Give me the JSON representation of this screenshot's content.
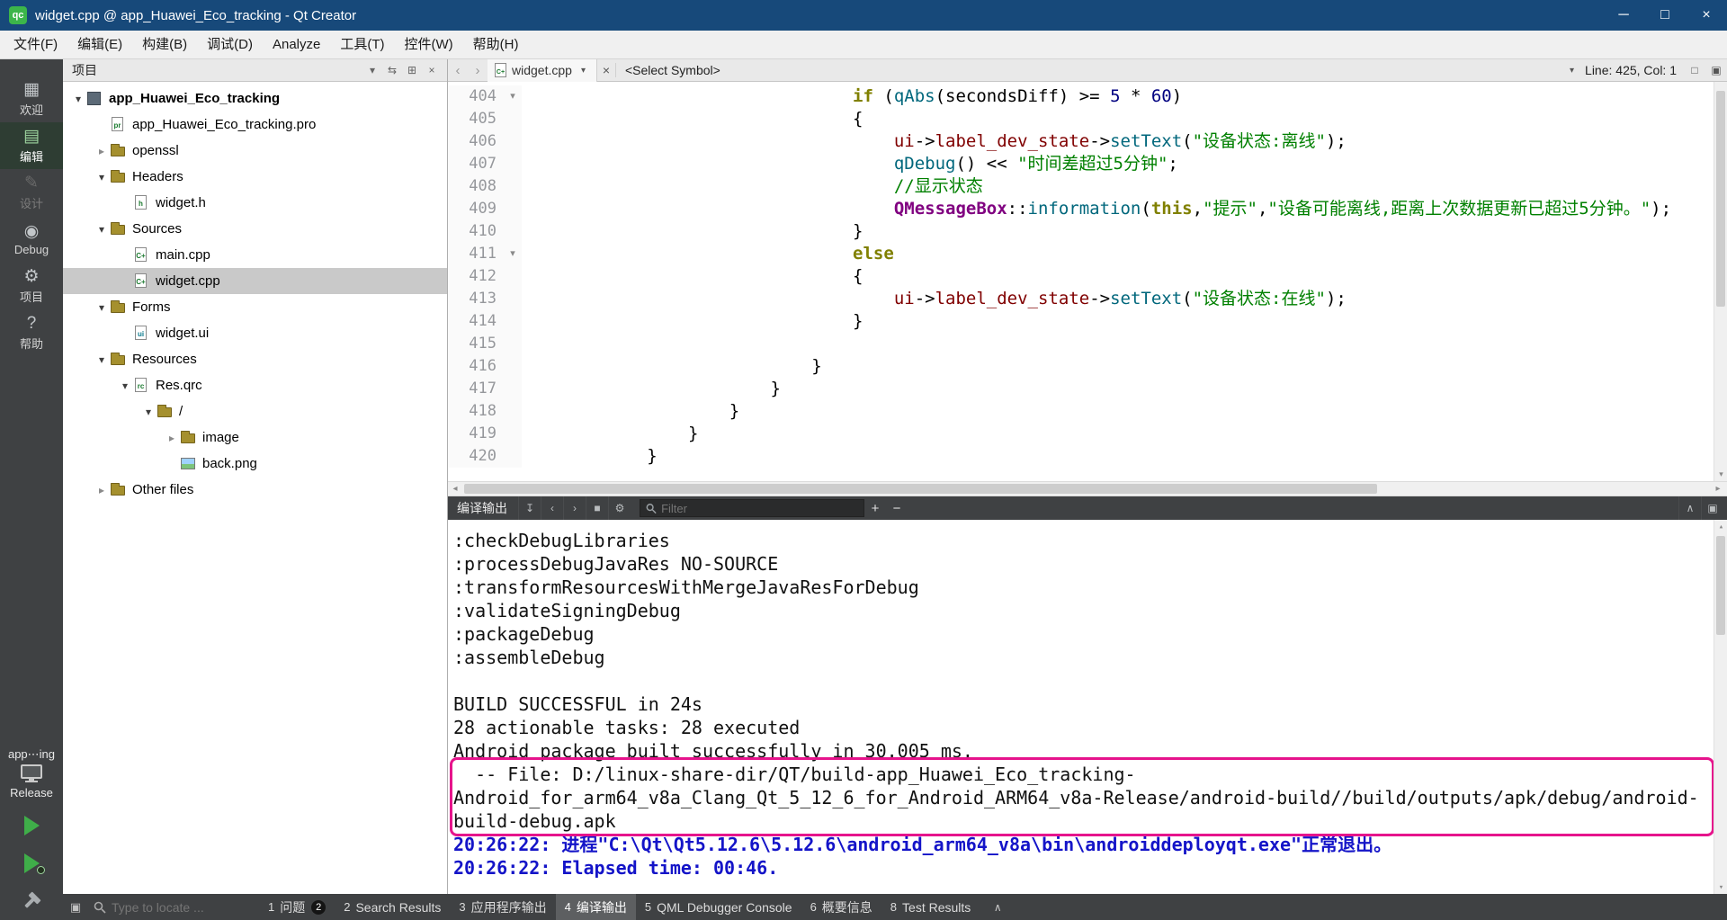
{
  "colors": {
    "titlebar": "#17497a",
    "annotation": "#e6148c",
    "run_green": "#3fae49",
    "output_link_blue": "#1414c8"
  },
  "titlebar": {
    "app_icon_label": "qc",
    "title": "widget.cpp @ app_Huawei_Eco_tracking - Qt Creator",
    "minimize_glyph": "─",
    "maximize_glyph": "□",
    "close_glyph": "×"
  },
  "menubar": {
    "items": [
      "文件(F)",
      "编辑(E)",
      "构建(B)",
      "调试(D)",
      "Analyze",
      "工具(T)",
      "控件(W)",
      "帮助(H)"
    ]
  },
  "sidebar": {
    "modes": [
      {
        "id": "welcome",
        "label": "欢迎",
        "glyph": "▦",
        "active": false,
        "disabled": false
      },
      {
        "id": "edit",
        "label": "编辑",
        "glyph": "▤",
        "active": true,
        "disabled": false
      },
      {
        "id": "design",
        "label": "设计",
        "glyph": "✎",
        "active": false,
        "disabled": true
      },
      {
        "id": "debug",
        "label": "Debug",
        "glyph": "◉",
        "active": false,
        "disabled": false
      },
      {
        "id": "projects",
        "label": "项目",
        "glyph": "⚙",
        "active": false,
        "disabled": false
      },
      {
        "id": "help",
        "label": "帮助",
        "glyph": "?",
        "active": false,
        "disabled": false
      }
    ],
    "kit_project": "app⋯ing",
    "kit_config": "Release"
  },
  "project_panel": {
    "title": "项目",
    "expander_glyphs": {
      "expanded": "▾",
      "collapsed": "▸"
    },
    "toolbar_icons": [
      {
        "name": "filter-icon",
        "glyph": "▾"
      },
      {
        "name": "sync-with-editor-icon",
        "glyph": "⇆"
      },
      {
        "name": "split-panel-icon",
        "glyph": "⊞"
      },
      {
        "name": "close-panel-icon",
        "glyph": "×"
      }
    ],
    "tree": [
      {
        "label": "app_Huawei_Eco_tracking",
        "indent": 0,
        "expander": "expanded",
        "icon": "project",
        "bold": true
      },
      {
        "label": "app_Huawei_Eco_tracking.pro",
        "indent": 1,
        "expander": "none",
        "icon": "pro"
      },
      {
        "label": "openssl",
        "indent": 1,
        "expander": "collapsed",
        "icon": "folder"
      },
      {
        "label": "Headers",
        "indent": 1,
        "expander": "expanded",
        "icon": "folder"
      },
      {
        "label": "widget.h",
        "indent": 2,
        "expander": "none",
        "icon": "h"
      },
      {
        "label": "Sources",
        "indent": 1,
        "expander": "expanded",
        "icon": "folder"
      },
      {
        "label": "main.cpp",
        "indent": 2,
        "expander": "none",
        "icon": "cpp"
      },
      {
        "label": "widget.cpp",
        "indent": 2,
        "expander": "none",
        "icon": "cpp",
        "selected": true
      },
      {
        "label": "Forms",
        "indent": 1,
        "expander": "expanded",
        "icon": "folder"
      },
      {
        "label": "widget.ui",
        "indent": 2,
        "expander": "none",
        "icon": "ui"
      },
      {
        "label": "Resources",
        "indent": 1,
        "expander": "expanded",
        "icon": "folder"
      },
      {
        "label": "Res.qrc",
        "indent": 2,
        "expander": "expanded",
        "icon": "qrc"
      },
      {
        "label": "/",
        "indent": 3,
        "expander": "expanded",
        "icon": "folder"
      },
      {
        "label": "image",
        "indent": 4,
        "expander": "collapsed",
        "icon": "folder"
      },
      {
        "label": "back.png",
        "indent": 4,
        "expander": "none",
        "icon": "png"
      },
      {
        "label": "Other files",
        "indent": 1,
        "expander": "collapsed",
        "icon": "folder"
      }
    ]
  },
  "editor": {
    "nav_back": "‹",
    "nav_forward": "›",
    "tab_label": "widget.cpp",
    "tab_icon_text": "C+",
    "tab_dropdown_glyph": "▾",
    "tab_close_glyph": "×",
    "symbol_selector": "<Select Symbol>",
    "cursor_dropdown_glyph": "▾",
    "cursor_position": "Line: 425, Col: 1",
    "split_icon_glyph": "□",
    "window_icon_glyph": "▣",
    "code": [
      {
        "num": "404",
        "fold": "▾",
        "tokens": [
          [
            "p",
            "                                "
          ],
          [
            "k",
            "if"
          ],
          [
            "p",
            " ("
          ],
          [
            "f",
            "qAbs"
          ],
          [
            "p",
            "(secondsDiff) >= "
          ],
          [
            "n",
            "5"
          ],
          [
            "p",
            " * "
          ],
          [
            "n",
            "60"
          ],
          [
            "p",
            ")"
          ]
        ]
      },
      {
        "num": "405",
        "fold": "",
        "tokens": [
          [
            "p",
            "                                {"
          ]
        ]
      },
      {
        "num": "406",
        "fold": "",
        "tokens": [
          [
            "p",
            "                                    "
          ],
          [
            "m",
            "ui"
          ],
          [
            "p",
            "->"
          ],
          [
            "m",
            "label_dev_state"
          ],
          [
            "p",
            "->"
          ],
          [
            "f",
            "setText"
          ],
          [
            "p",
            "("
          ],
          [
            "s",
            "\"设备状态:离线\""
          ],
          [
            "p",
            ");"
          ]
        ]
      },
      {
        "num": "407",
        "fold": "",
        "tokens": [
          [
            "p",
            "                                    "
          ],
          [
            "f",
            "qDebug"
          ],
          [
            "p",
            "() << "
          ],
          [
            "s",
            "\"时间差超过5分钟\""
          ],
          [
            "p",
            ";"
          ]
        ]
      },
      {
        "num": "408",
        "fold": "",
        "tokens": [
          [
            "p",
            "                                    "
          ],
          [
            "c",
            "//显示状态"
          ]
        ]
      },
      {
        "num": "409",
        "fold": "",
        "tokens": [
          [
            "p",
            "                                    "
          ],
          [
            "t",
            "QMessageBox"
          ],
          [
            "p",
            "::"
          ],
          [
            "f",
            "information"
          ],
          [
            "p",
            "("
          ],
          [
            "k",
            "this"
          ],
          [
            "p",
            ","
          ],
          [
            "s",
            "\"提示\""
          ],
          [
            "p",
            ","
          ],
          [
            "s",
            "\"设备可能离线,距离上次数据更新已超过5分钟。\""
          ],
          [
            "p",
            ");"
          ]
        ]
      },
      {
        "num": "410",
        "fold": "",
        "tokens": [
          [
            "p",
            "                                }"
          ]
        ]
      },
      {
        "num": "411",
        "fold": "▾",
        "tokens": [
          [
            "p",
            "                                "
          ],
          [
            "k",
            "else"
          ]
        ]
      },
      {
        "num": "412",
        "fold": "",
        "tokens": [
          [
            "p",
            "                                {"
          ]
        ]
      },
      {
        "num": "413",
        "fold": "",
        "tokens": [
          [
            "p",
            "                                    "
          ],
          [
            "m",
            "ui"
          ],
          [
            "p",
            "->"
          ],
          [
            "m",
            "label_dev_state"
          ],
          [
            "p",
            "->"
          ],
          [
            "f",
            "setText"
          ],
          [
            "p",
            "("
          ],
          [
            "s",
            "\"设备状态:在线\""
          ],
          [
            "p",
            ");"
          ]
        ]
      },
      {
        "num": "414",
        "fold": "",
        "tokens": [
          [
            "p",
            "                                }"
          ]
        ]
      },
      {
        "num": "415",
        "fold": "",
        "tokens": []
      },
      {
        "num": "416",
        "fold": "",
        "tokens": [
          [
            "p",
            "                            }"
          ]
        ]
      },
      {
        "num": "417",
        "fold": "",
        "tokens": [
          [
            "p",
            "                        }"
          ]
        ]
      },
      {
        "num": "418",
        "fold": "",
        "tokens": [
          [
            "p",
            "                    }"
          ]
        ]
      },
      {
        "num": "419",
        "fold": "",
        "tokens": [
          [
            "p",
            "                }"
          ]
        ]
      },
      {
        "num": "420",
        "fold": "",
        "tokens": [
          [
            "p",
            "            }"
          ]
        ]
      }
    ]
  },
  "output_pane": {
    "title": "编译输出",
    "icons_left": [
      {
        "name": "scroll-to-end-icon",
        "glyph": "↧"
      },
      {
        "name": "previous-item-icon",
        "glyph": "‹"
      },
      {
        "name": "next-item-icon",
        "glyph": "›"
      },
      {
        "name": "stop-icon",
        "glyph": "■"
      },
      {
        "name": "settings-icon",
        "glyph": "⚙"
      }
    ],
    "filter_placeholder": "Filter",
    "zoom_in": "+",
    "zoom_out": "−",
    "icons_right": [
      {
        "name": "maximize-pane-icon",
        "glyph": "∧"
      },
      {
        "name": "detach-pane-icon",
        "glyph": "▣"
      }
    ],
    "lines": [
      {
        "style": "plain",
        "text": ":checkDebugLibraries"
      },
      {
        "style": "plain",
        "text": ":processDebugJavaRes NO-SOURCE"
      },
      {
        "style": "plain",
        "text": ":transformResourcesWithMergeJavaResForDebug"
      },
      {
        "style": "plain",
        "text": ":validateSigningDebug"
      },
      {
        "style": "plain",
        "text": ":packageDebug"
      },
      {
        "style": "plain",
        "text": ":assembleDebug"
      },
      {
        "style": "plain",
        "text": ""
      },
      {
        "style": "plain",
        "text": "BUILD SUCCESSFUL in 24s"
      },
      {
        "style": "plain",
        "text": "28 actionable tasks: 28 executed"
      },
      {
        "style": "plain",
        "text": "Android package built successfully in 30.005 ms."
      },
      {
        "style": "plain",
        "text": "  -- File: D:/linux-share-dir/QT/build-app_Huawei_Eco_tracking-"
      },
      {
        "style": "plain",
        "text": "Android_for_arm64_v8a_Clang_Qt_5_12_6_for_Android_ARM64_v8a-Release/android-build//build/outputs/apk/debug/android-"
      },
      {
        "style": "plain",
        "text": "build-debug.apk"
      },
      {
        "style": "blue",
        "text": "20:26:22: 进程\"C:\\Qt\\Qt5.12.6\\5.12.6\\android_arm64_v8a\\bin\\androiddeployqt.exe\"正常退出。"
      },
      {
        "style": "blue",
        "text": "20:26:22: Elapsed time: 00:46."
      }
    ]
  },
  "statusbar": {
    "toggle_glyph": "▣",
    "locator_placeholder": "Type to locate ...",
    "panes": [
      {
        "num": "1",
        "label": "问题",
        "badge": "2"
      },
      {
        "num": "2",
        "label": "Search Results"
      },
      {
        "num": "3",
        "label": "应用程序输出"
      },
      {
        "num": "4",
        "label": "编译输出",
        "active": true
      },
      {
        "num": "5",
        "label": "QML Debugger Console"
      },
      {
        "num": "6",
        "label": "概要信息"
      },
      {
        "num": "8",
        "label": "Test Results"
      }
    ],
    "expand_glyph": "∧"
  },
  "scrollbars": {
    "up": "▴",
    "down": "▾",
    "left": "◂",
    "right": "▸"
  }
}
